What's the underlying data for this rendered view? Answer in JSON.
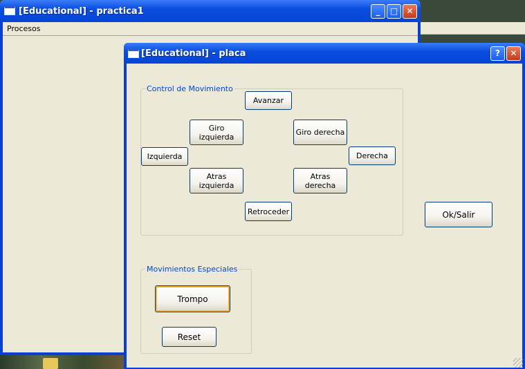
{
  "back_window": {
    "title": "[Educational] - practica1",
    "menu": [
      "Procesos"
    ],
    "controls": {
      "minimize": "_",
      "maximize": "□",
      "close": "✕"
    }
  },
  "dialog": {
    "title": "[Educational] - placa",
    "controls": {
      "help": "?",
      "close": "✕"
    },
    "movement_group": {
      "label": "Control de Movimiento",
      "buttons": {
        "forward": "Avanzar",
        "turn_left": "Giro izquierda",
        "turn_right": "Giro derecha",
        "left": "Izquierda",
        "right": "Derecha",
        "back_left": "Atras izquierda",
        "back_right": "Atras derecha",
        "backward": "Retroceder"
      }
    },
    "special_group": {
      "label": "Movimientos Especiales",
      "buttons": {
        "spin": "Trompo",
        "reset": "Reset"
      }
    },
    "ok_exit": "Ok/Salir"
  },
  "colors": {
    "title_bar": "#0a4ee0",
    "face": "#ece9d8",
    "group_label": "#0046d5",
    "close_button": "#c43a1a"
  }
}
